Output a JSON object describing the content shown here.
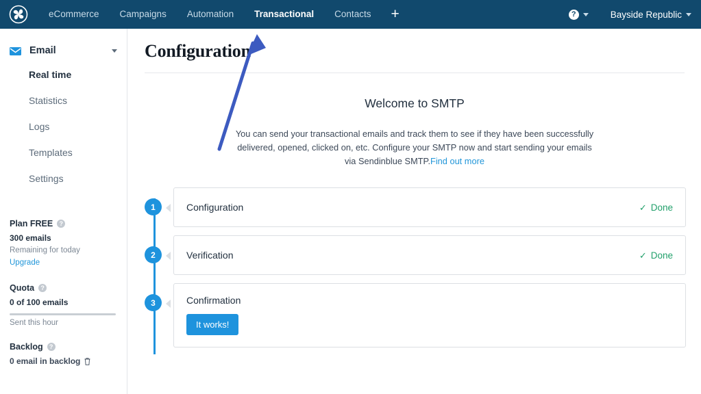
{
  "navbar": {
    "logo_icon": "sendinblue-pinwheel-logo",
    "items": [
      {
        "label": "eCommerce",
        "active": false
      },
      {
        "label": "Campaigns",
        "active": false
      },
      {
        "label": "Automation",
        "active": false
      },
      {
        "label": "Transactional",
        "active": true
      },
      {
        "label": "Contacts",
        "active": false
      }
    ],
    "add_label": "+",
    "help_label": "?",
    "account_label": "Bayside Republic"
  },
  "sidebar": {
    "section": {
      "icon": "envelope-icon",
      "label": "Email"
    },
    "links": [
      {
        "label": "Real time",
        "active": true
      },
      {
        "label": "Statistics",
        "active": false
      },
      {
        "label": "Logs",
        "active": false
      },
      {
        "label": "Templates",
        "active": false
      },
      {
        "label": "Settings",
        "active": false
      }
    ],
    "plan": {
      "title": "Plan FREE",
      "amount": "300 emails",
      "subtitle": "Remaining for today",
      "upgrade_label": "Upgrade"
    },
    "quota": {
      "title": "Quota",
      "value": "0 of 100 emails",
      "percent": 0,
      "subtitle": "Sent this hour"
    },
    "backlog": {
      "title": "Backlog",
      "value": "0 email in backlog",
      "trash_icon": "trash-icon"
    }
  },
  "main": {
    "page_title": "Configuration",
    "welcome_title": "Welcome to SMTP",
    "welcome_body": "You can send your transactional emails and track them to see if they have been successfully delivered, opened, clicked on, etc. Configure your SMTP now and start sending your emails via Sendinblue SMTP.",
    "welcome_link": "Find out more",
    "steps": [
      {
        "number": "1",
        "label": "Configuration",
        "status": "Done",
        "has_button": false
      },
      {
        "number": "2",
        "label": "Verification",
        "status": "Done",
        "has_button": false
      },
      {
        "number": "3",
        "label": "Confirmation",
        "status": "",
        "has_button": true,
        "button_label": "It works!"
      }
    ]
  },
  "annotation": {
    "arrow_icon": "blue-arrow-annotation",
    "color": "#3d5bc0"
  },
  "colors": {
    "navbar_bg": "#11496d",
    "accent_blue": "#1e93dd",
    "link_blue": "#2196d9",
    "success_green": "#22a06b",
    "annotation_blue": "#3d5bc0"
  }
}
